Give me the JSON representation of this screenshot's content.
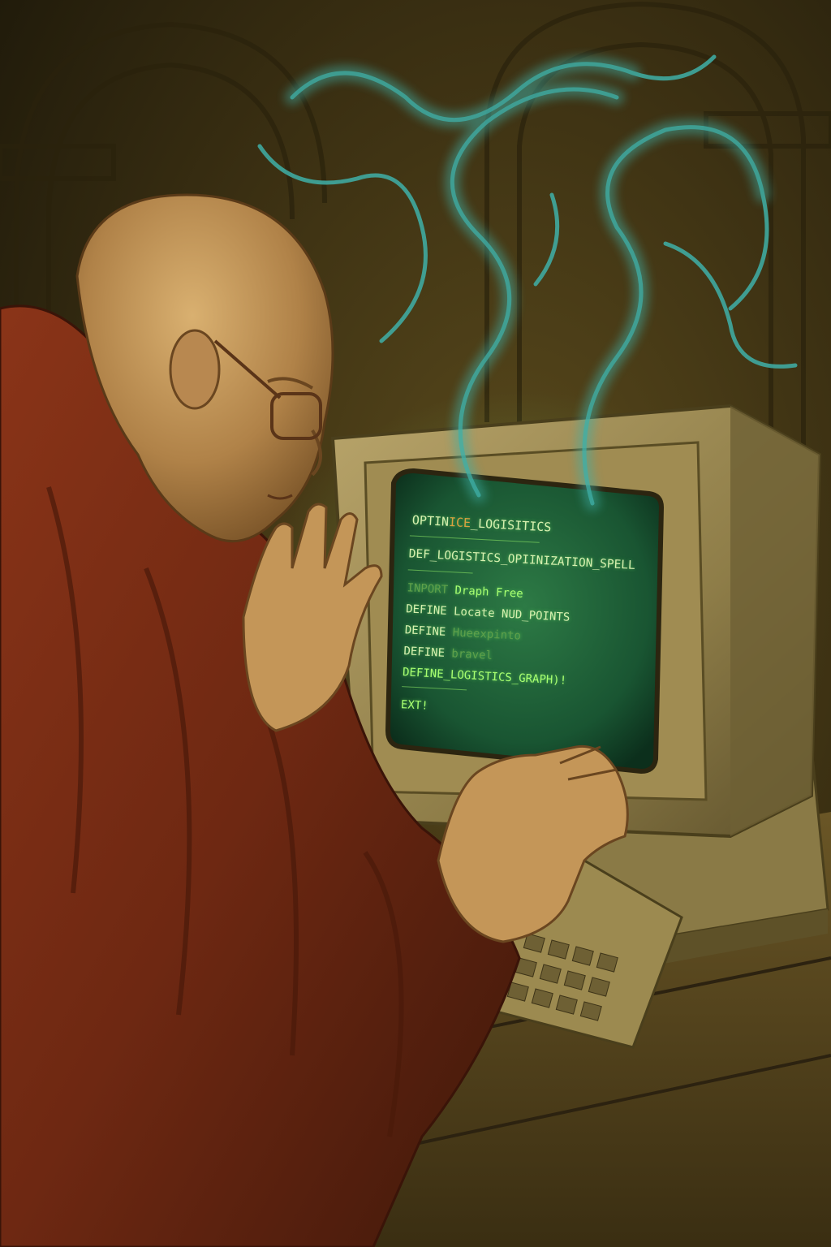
{
  "screen": {
    "header_pre": "OPTIN",
    "header_mid": "ICE",
    "header_post": "_LOGISITICS",
    "def_line": "DEF_LOGISTICS_OPIINIZATION_SPELL",
    "lines": [
      {
        "kw": "INPORT",
        "text": "Draph Free"
      },
      {
        "kw": "DEFINE",
        "text": "Locate NUD_POINTS"
      },
      {
        "kw": "DEFINE",
        "text": "Hueexpinto"
      },
      {
        "kw": "DEFINE",
        "text": "bravel"
      }
    ],
    "final_define": "DEFINE_LOGISTICS_GRAPH)!",
    "exit": "EXT!"
  },
  "colors": {
    "robe": "#7a2a14",
    "screen_glow": "#1f6b3a",
    "smoke": "#3fb0a8",
    "terminal_text": "#8ee06a"
  }
}
